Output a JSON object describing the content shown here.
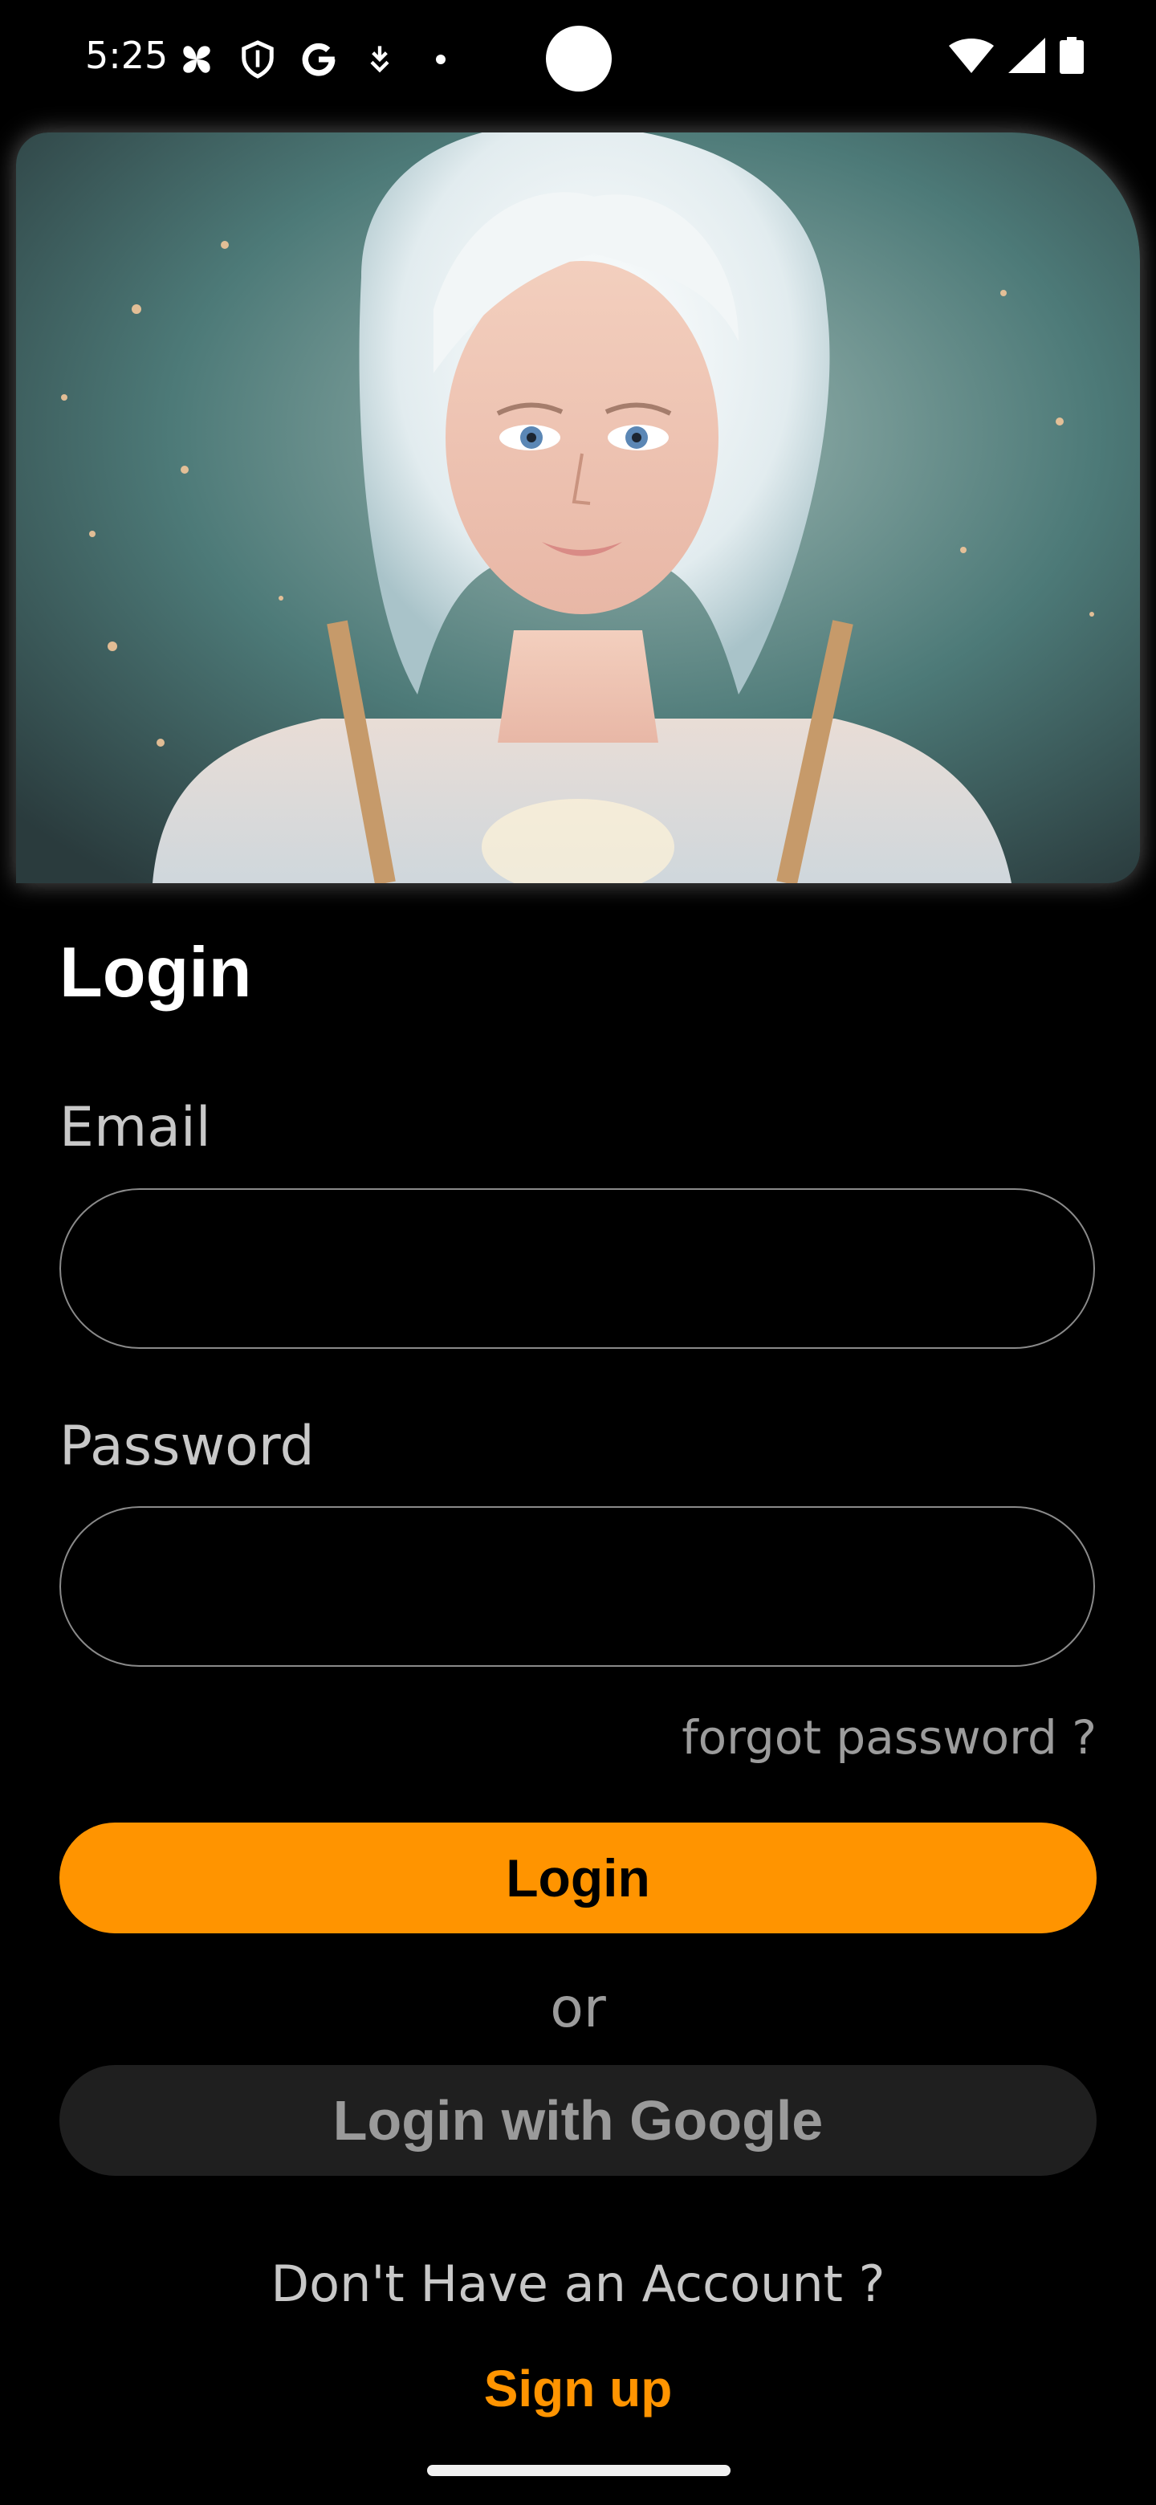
{
  "status_bar": {
    "time": "5:25",
    "left_icons": [
      "pinwheel-icon",
      "shield-icon",
      "google-g-icon",
      "download-icon",
      "dot-icon"
    ],
    "right_icons": [
      "wifi-icon",
      "signal-icon",
      "battery-icon"
    ]
  },
  "hero": {
    "image": "portrait-illustration"
  },
  "screen": {
    "title": "Login"
  },
  "form": {
    "email_label": "Email",
    "email_value": "",
    "password_label": "Password",
    "password_value": "",
    "forgot_link": "forgot password ?"
  },
  "actions": {
    "login_button": "Login",
    "or_text": "or",
    "google_button": "Login with Google",
    "no_account_text": "Don't Have an Account ?",
    "signup_link": "Sign up"
  },
  "colors": {
    "accent": "#FF9400",
    "background": "#000000",
    "secondary_button": "#1F1F1F"
  }
}
